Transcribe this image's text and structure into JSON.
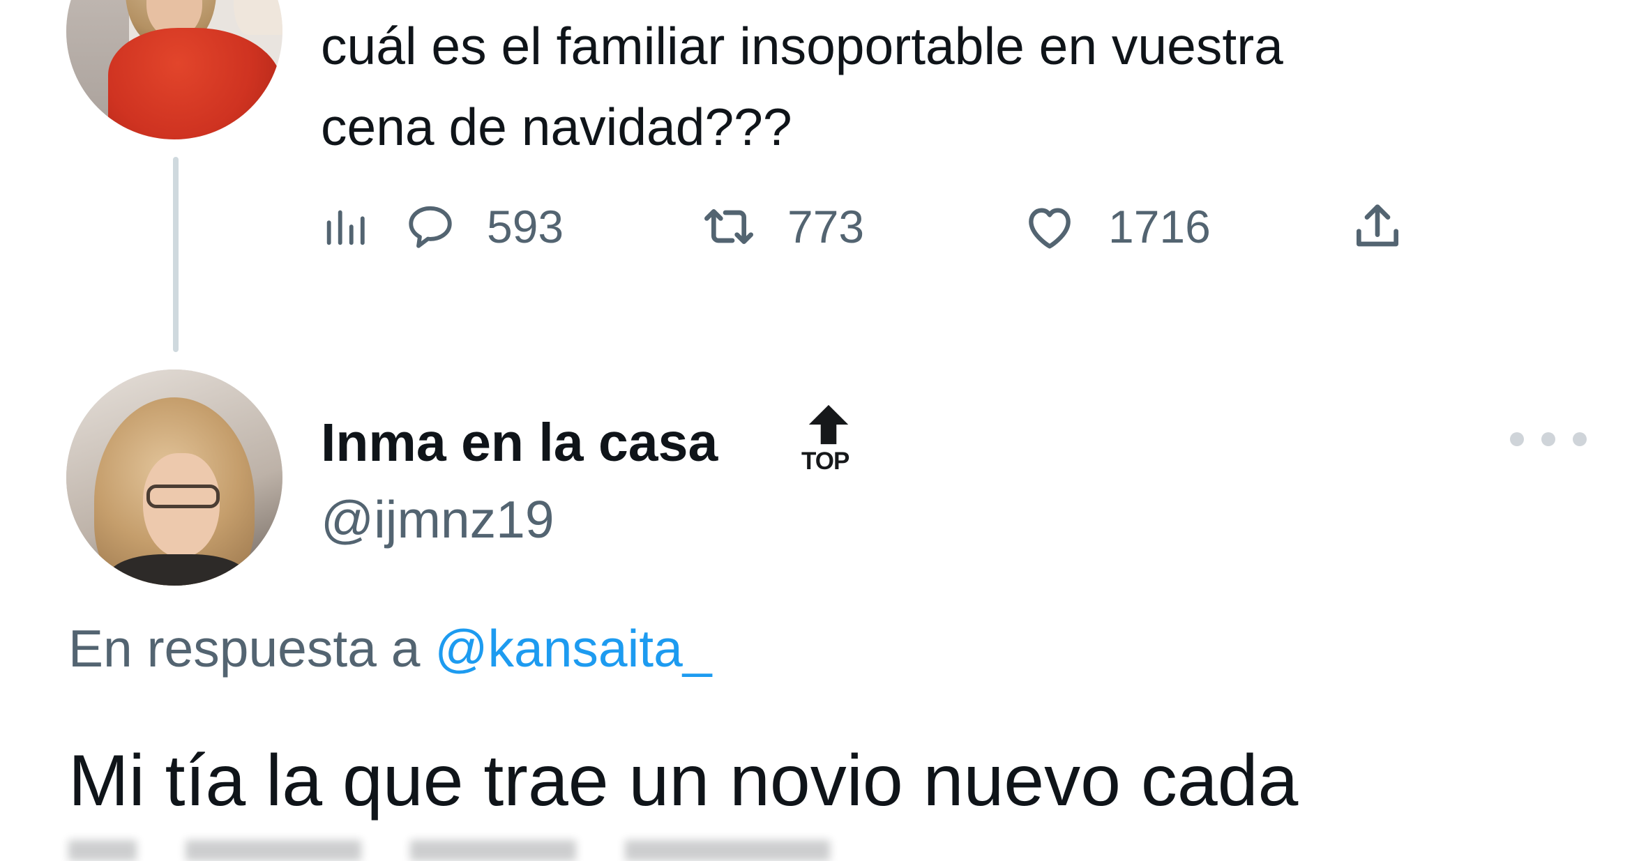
{
  "parent_tweet": {
    "text_line1": "cuál es el familiar insoportable en vuestra",
    "text_line2": "cena de navidad???",
    "actions": {
      "analytics_icon": "bar-chart-icon",
      "reply_icon": "speech-bubble-icon",
      "reply_count": "593",
      "retweet_icon": "retweet-arrows-icon",
      "retweet_count": "773",
      "like_icon": "heart-icon",
      "like_count": "1716",
      "share_icon": "upload-icon"
    }
  },
  "reply_tweet": {
    "display_name": "Inma en la casa",
    "badge_label": "TOP",
    "handle": "@ijmnz19",
    "reply_context_prefix": "En respuesta a",
    "reply_context_mention": "@kansaita_",
    "text_line1": "Mi tía la que trae un novio nuevo cada"
  },
  "colors": {
    "text_primary": "#0f1419",
    "text_secondary": "#536471",
    "link": "#1d9bf0",
    "thread_line": "#cfd9de"
  }
}
